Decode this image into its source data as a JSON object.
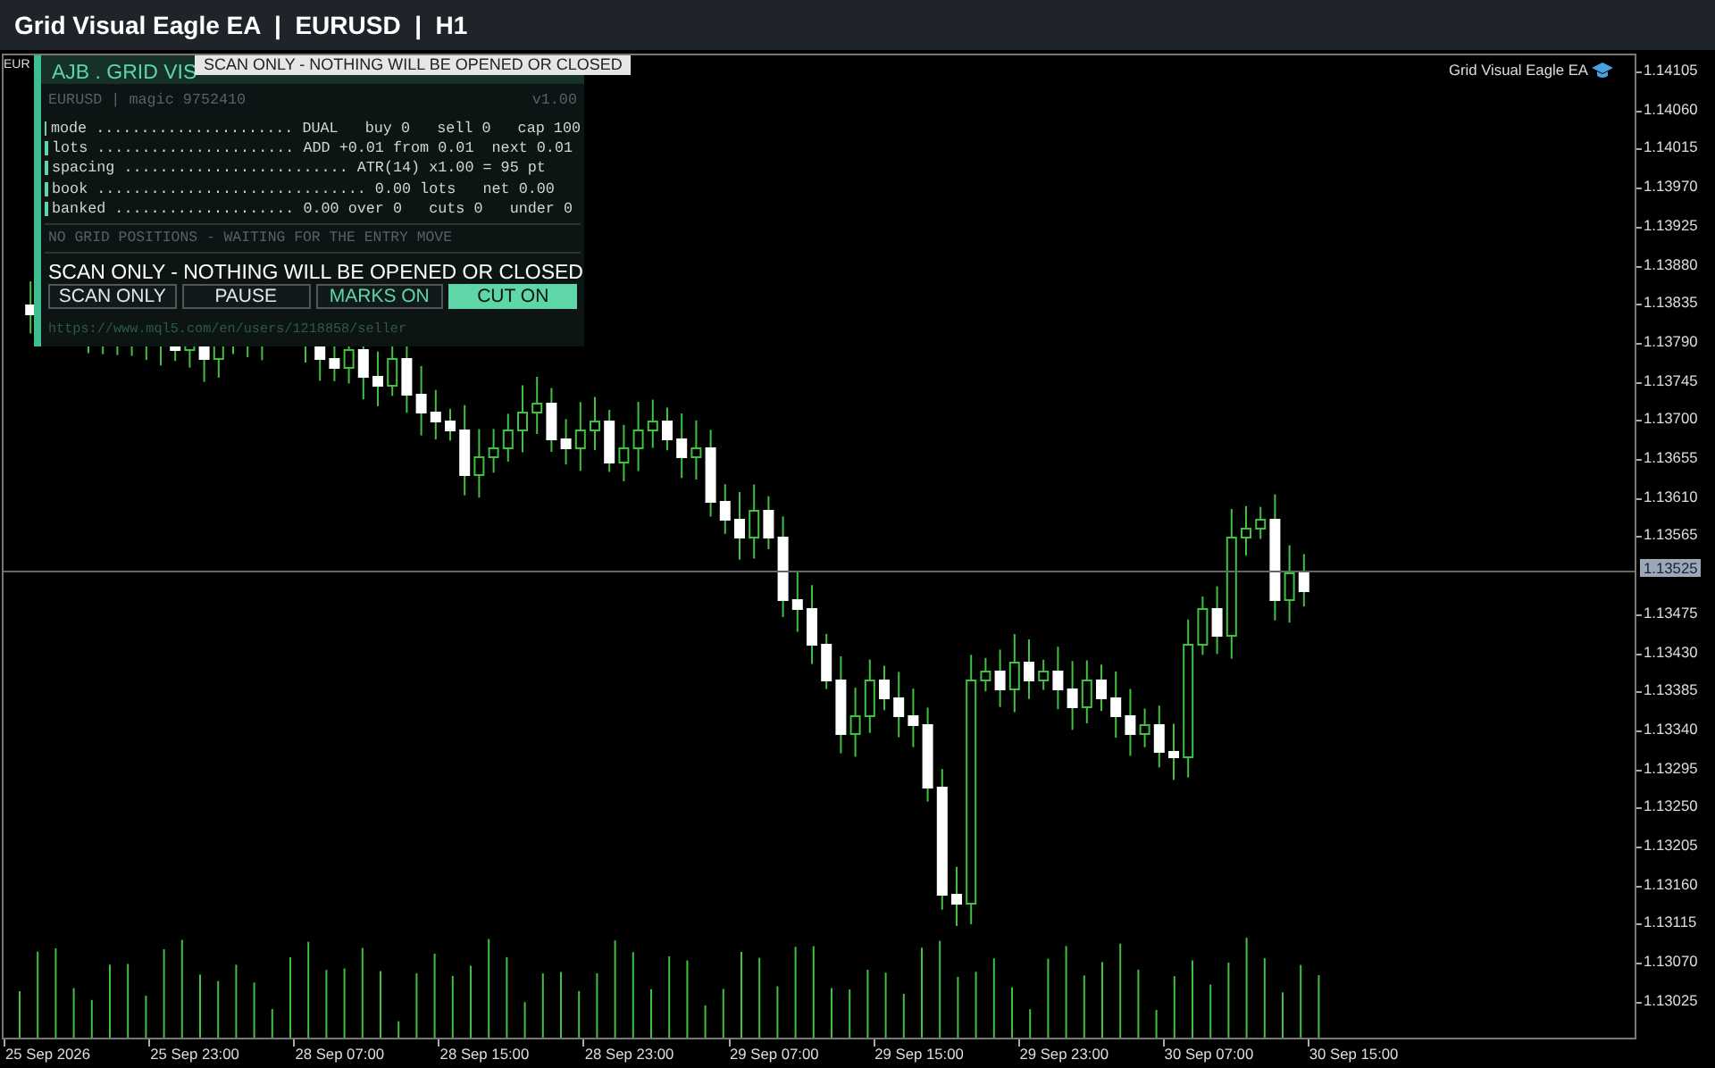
{
  "window": {
    "title": "Grid Visual Eagle EA  |  EURUSD  |  H1"
  },
  "chart": {
    "symbol_label": "EUR",
    "ea_label": "Grid Visual Eagle EA",
    "current_price": "1.13525",
    "price_axis": [
      "1.14105",
      "1.14060",
      "1.14015",
      "1.13970",
      "1.13925",
      "1.13880",
      "1.13835",
      "1.13790",
      "1.13745",
      "1.13700",
      "1.13655",
      "1.13610",
      "1.13565",
      "1.13475",
      "1.13430",
      "1.13385",
      "1.13340",
      "1.13295",
      "1.13250",
      "1.13205",
      "1.13160",
      "1.13115",
      "1.13070",
      "1.13025"
    ],
    "time_axis": [
      "25 Sep 2026",
      "25 Sep 23:00",
      "28 Sep 07:00",
      "28 Sep 15:00",
      "28 Sep 23:00",
      "29 Sep 07:00",
      "29 Sep 15:00",
      "29 Sep 23:00",
      "30 Sep 07:00",
      "30 Sep 15:00"
    ]
  },
  "panel": {
    "title": "AJB . GRID VIS",
    "tooltip": "SCAN ONLY - NOTHING WILL BE OPENED OR CLOSED",
    "account": "EURUSD  |  magic 9752410",
    "version": "v1.00",
    "rows": [
      "mode ...................... DUAL   buy 0   sell 0   cap 100",
      "lots ...................... ADD +0.01 from 0.01  next 0.01",
      "spacing ......................... ATR(14) x1.00 = 95 pt",
      "book .............................. 0.00 lots   net 0.00",
      "banked .................... 0.00 over 0   cuts 0   under 0"
    ],
    "status": "NO GRID POSITIONS - WAITING FOR THE ENTRY MOVE",
    "mode_banner": "SCAN ONLY - NOTHING WILL BE OPENED OR CLOSED",
    "buttons": [
      {
        "label": "SCAN ONLY",
        "kind": "outline"
      },
      {
        "label": "PAUSE",
        "kind": "outline"
      },
      {
        "label": "MARKS ON",
        "kind": "toggle"
      },
      {
        "label": "CUT ON",
        "kind": "active"
      }
    ],
    "link": "https://www.mql5.com/en/users/1218858/seller"
  }
}
